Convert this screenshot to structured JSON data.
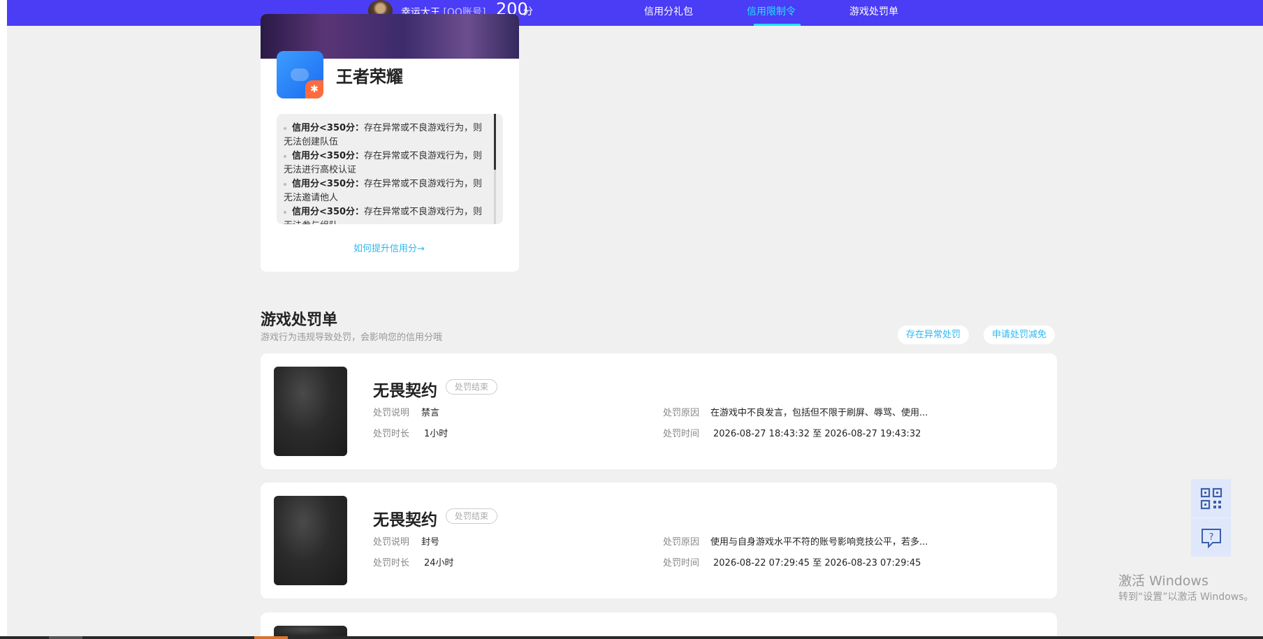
{
  "header": {
    "user_name": "幸运大王",
    "account_tag": "[QQ账号]",
    "score": "200",
    "score_unit": "分",
    "nav": [
      {
        "label": "信用分礼包",
        "active": false
      },
      {
        "label": "信用限制令",
        "active": true
      },
      {
        "label": "游戏处罚单",
        "active": false
      }
    ]
  },
  "game_card": {
    "title": "王者荣耀",
    "restrictions": [
      {
        "bold": "信用分<350分：",
        "text": "存在异常或不良游戏行为，则无法创建队伍"
      },
      {
        "bold": "信用分<350分：",
        "text": "存在异常或不良游戏行为，则无法进行高校认证"
      },
      {
        "bold": "信用分<350分：",
        "text": "存在异常或不良游戏行为，则无法邀请他人"
      },
      {
        "bold": "信用分<350分：",
        "text": "存在异常或不良游戏行为，则无法参与组队"
      }
    ],
    "improve_link": "如何提升信用分→"
  },
  "penalty_section": {
    "title": "游戏处罚单",
    "subtitle": "游戏行为违规导致处罚，会影响您的信用分哦",
    "btn_abnormal": "存在异常处罚",
    "btn_appeal": "申请处罚减免",
    "labels": {
      "desc": "处罚说明",
      "duration": "处罚时长",
      "reason": "处罚原因",
      "time": "处罚时间"
    },
    "items": [
      {
        "game": "无畏契约",
        "status": "处罚结束",
        "desc": "禁言",
        "duration": "1小时",
        "reason": "在游戏中不良发言，包括但不限于刷屏、辱骂、使用...",
        "time": "2026-08-27 18:43:32 至 2026-08-27 19:43:32"
      },
      {
        "game": "无畏契约",
        "status": "处罚结束",
        "desc": "封号",
        "duration": "24小时",
        "reason": "使用与自身游戏水平不符的账号影响竞技公平，若多...",
        "time": "2026-08-22 07:29:45 至 2026-08-23 07:29:45"
      }
    ]
  },
  "side_buttons": {
    "qr_icon": "qrcode-icon",
    "help_icon": "help-chat-icon"
  },
  "watermark": {
    "title": "激活 Windows",
    "subtitle": "转到“设置”以激活 Windows。"
  },
  "colors": {
    "nav_bg": "#4b3cf5",
    "nav_active": "#22e3ff",
    "link": "#2bb8f0",
    "page_bg": "#f0f0f0"
  }
}
